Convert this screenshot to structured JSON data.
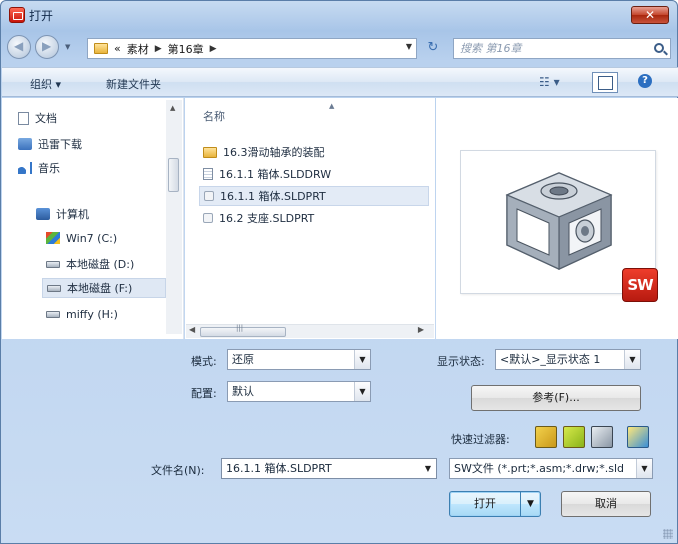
{
  "window": {
    "title": "打开"
  },
  "nav": {
    "breadcrumbs": [
      "«",
      "素材",
      "第16章"
    ],
    "search_placeholder": "搜索 第16章"
  },
  "toolbar": {
    "organize": "组织 ▾",
    "new_folder": "新建文件夹",
    "view_icon": "☷ ▾"
  },
  "sidebar": {
    "items": [
      {
        "label": "文档",
        "icon": "document-icon"
      },
      {
        "label": "迅雷下载",
        "icon": "download-icon"
      },
      {
        "label": "音乐",
        "icon": "music-icon"
      },
      {
        "label": "计算机",
        "icon": "computer-icon"
      },
      {
        "label": "Win7 (C:)",
        "icon": "windows-drive-icon"
      },
      {
        "label": "本地磁盘 (D:)",
        "icon": "drive-icon"
      },
      {
        "label": "本地磁盘 (F:)",
        "icon": "drive-icon"
      },
      {
        "label": "miffy (H:)",
        "icon": "drive-icon"
      }
    ],
    "selected_index": 6
  },
  "filelist": {
    "column_name": "名称",
    "files": [
      {
        "name": "16.3滑动轴承的装配",
        "type": "folder"
      },
      {
        "name": "16.1.1 箱体.SLDDRW",
        "type": "drawing"
      },
      {
        "name": "16.1.1 箱体.SLDPRT",
        "type": "part"
      },
      {
        "name": "16.2 支座.SLDPRT",
        "type": "part"
      }
    ],
    "selected_index": 2,
    "scroll_grip": "|||"
  },
  "preview": {
    "logo_text": "SW"
  },
  "form": {
    "mode_label": "模式:",
    "mode_value": "还原",
    "config_label": "配置:",
    "config_value": "默认",
    "display_state_label": "显示状态:",
    "display_state_value": "<默认>_显示状态 1",
    "references_button": "参考(F)...",
    "quick_filter_label": "快速过滤器:",
    "filename_label": "文件名(N):",
    "filename_value": "16.1.1 箱体.SLDPRT",
    "filetype_value": "SW文件 (*.prt;*.asm;*.drw;*.sld",
    "open_button": "打开",
    "cancel_button": "取消"
  },
  "colors": {
    "accent": "#2c6fc1",
    "brand": "#d8271a",
    "selection": "#e3ebf6"
  }
}
